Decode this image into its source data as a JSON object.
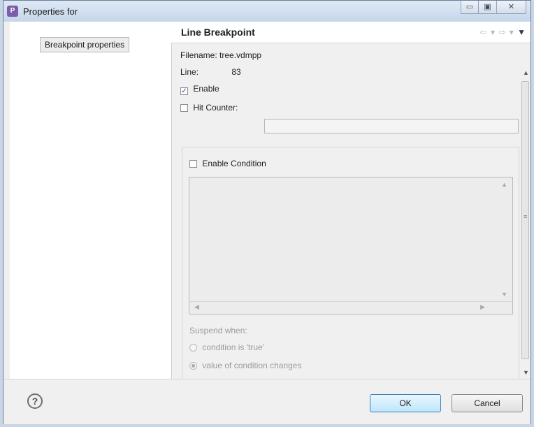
{
  "window": {
    "title": "Properties for",
    "buttons": {
      "minimize": "▭",
      "maximize": "▣",
      "close": "✕"
    }
  },
  "sidebar": {
    "items": [
      {
        "label": "Breakpoint properties"
      }
    ]
  },
  "header": {
    "title": "Line Breakpoint",
    "nav": {
      "back": "⇦",
      "back_menu": "▾",
      "forward": "⇨",
      "forward_menu": "▾",
      "view_menu": "▼"
    }
  },
  "form": {
    "filename_label": "Filename:",
    "filename_value": "tree.vdmpp",
    "line_label": "Line:",
    "line_value": "83",
    "enable_label": "Enable",
    "enable_checked": true,
    "hit_counter_label": "Hit Counter:",
    "hit_counter_checked": false,
    "hit_counter_value": "",
    "enable_condition_label": "Enable Condition",
    "enable_condition_checked": false,
    "condition_text": "",
    "suspend_when_label": "Suspend when:",
    "options": [
      {
        "label": "condition is 'true'",
        "selected": false
      },
      {
        "label": "value of condition changes",
        "selected": true
      }
    ]
  },
  "footer": {
    "ok_label": "OK",
    "cancel_label": "Cancel",
    "help_glyph": "?"
  },
  "icons": {
    "check": "✓"
  }
}
